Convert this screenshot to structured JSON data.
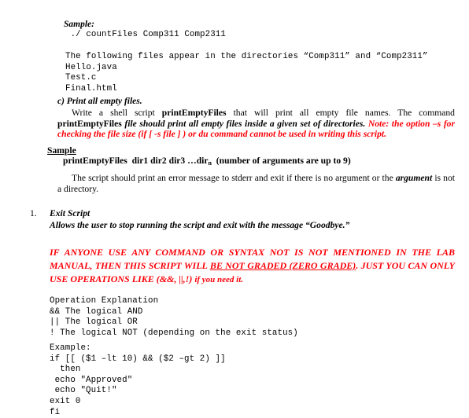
{
  "document": {
    "type": "lab-assignment-page",
    "colors": {
      "text": "#000000",
      "warning_red": "#fb0007",
      "background": "#ffffff"
    }
  },
  "sample_run": {
    "label": "Sample:",
    "command": " ./ countFiles Comp311 Comp2311",
    "output_lines": [
      "The following files appear in the directories “Comp311” and “Comp2311”",
      "Hello.java",
      "Test.c",
      "Final.html"
    ]
  },
  "section_c": {
    "heading": "c) Print all empty files.",
    "para_1_part_1": "Write a shell script ",
    "para_1_bold_1": "printEmptyFiles",
    "para_1_part_2": " that will print all empty file names. The command ",
    "para_1_bold_2": "printEmptyFiles",
    "para_1_part_3": " file should print all empty files inside a given set of directories. ",
    "para_1_red": "Note: the option –s for checking the file size (if [ -s file ] ) or du  command cannot be used in writing this script.",
    "sample_heading": "Sample",
    "sample_usage_command": "printEmptyFiles  dir1 dir2 dir3 …dir",
    "sample_usage_subscript": "n",
    "sample_usage_note": "  (number of arguments are up to 9)",
    "para_2_part_1": "The script should print an error message to stderr and exit if there is no argument or the ",
    "para_2_italic": "argument",
    "para_2_part_2": " is not a directory."
  },
  "exit_script_item": {
    "marker": "1.",
    "title": "Exit Script",
    "description": "Allows the user to stop running the script and exit with the message “Goodbye.”"
  },
  "warning": {
    "part_1": "IF ANYONE USE ANY COMMAND OR SYNTAX NOT IS NOT MENTIONED IN THE LAB MANUAL, THEN THIS SCRIPT WILL ",
    "underlined": "BE NOT GRADED (ZERO GRADE)",
    "part_2": ". JUST YOU CAN ONLY USE OPERATIONS LIKE (&&, ||,!) ",
    "part_3": "if you need it."
  },
  "operations_table": {
    "lines": [
      "Operation Explanation",
      "&& The logical AND",
      "|| The logical OR",
      "! The logical NOT (depending on the exit status)"
    ]
  },
  "example_block": {
    "lines": [
      "Example:",
      "if [[ ($1 –lt 10) && ($2 –gt 2) ]]",
      "  then",
      " echo \"Approved\"",
      " echo \"Quit!\"",
      "exit 0",
      "fi"
    ]
  }
}
